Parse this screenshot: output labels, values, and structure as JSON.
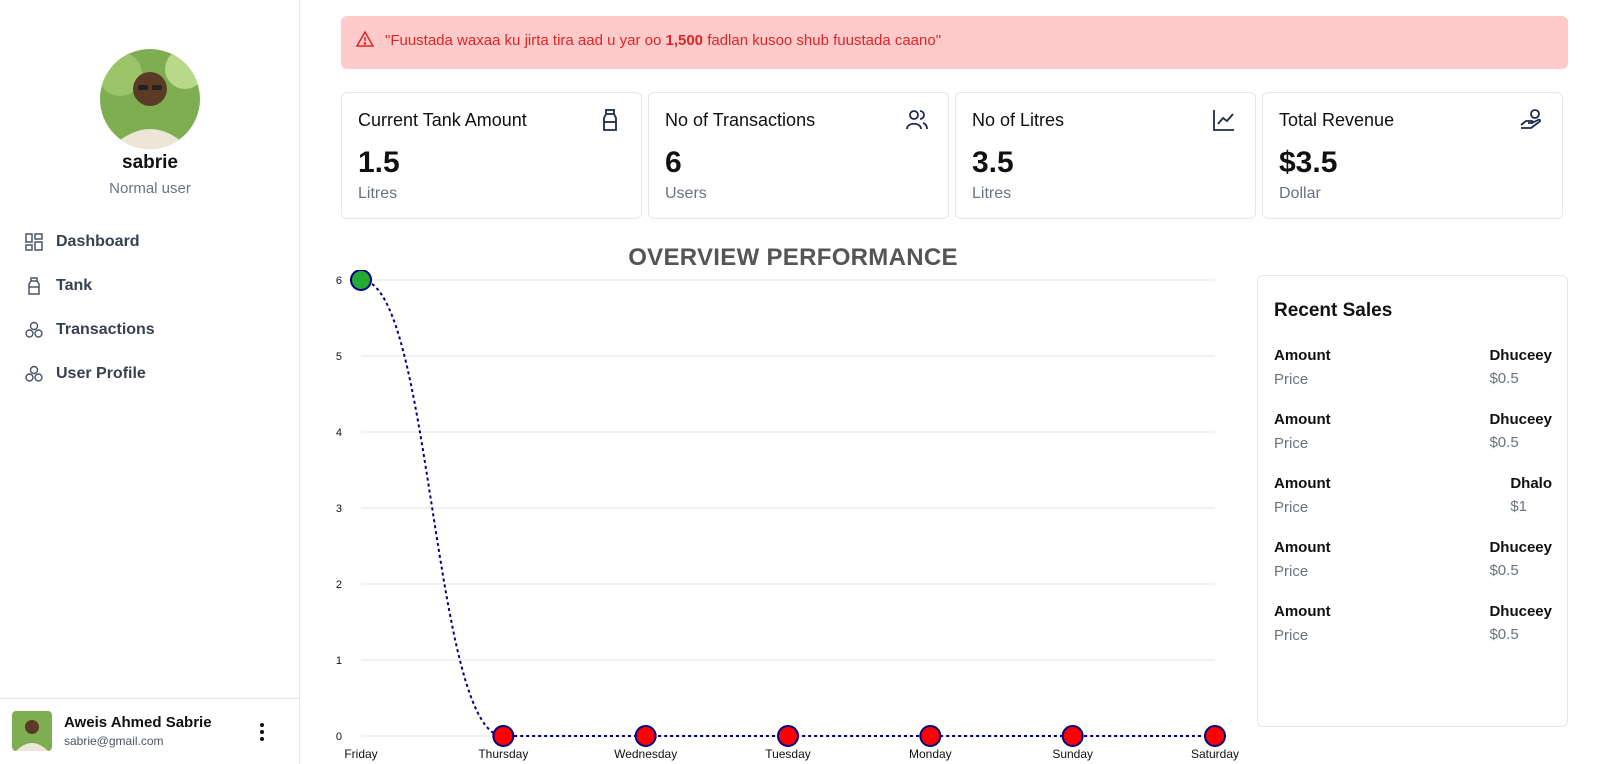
{
  "sidebar": {
    "profile": {
      "name": "sabrie",
      "role": "Normal user"
    },
    "nav": [
      {
        "label": "Dashboard",
        "icon": "dashboard-grid-icon"
      },
      {
        "label": "Tank",
        "icon": "bottle-icon"
      },
      {
        "label": "Transactions",
        "icon": "cubes-icon"
      },
      {
        "label": "User Profile",
        "icon": "cubes-icon"
      }
    ],
    "user": {
      "name": "Aweis Ahmed Sabrie",
      "email": "sabrie@gmail.com"
    }
  },
  "alert": {
    "prefix": "\"Fuustada waxaa ku jirta tira aad u yar oo ",
    "highlight": "1,500",
    "suffix": " fadlan kusoo shub fuustada caano\"",
    "icon": "warning-triangle-icon",
    "color": "#dc2626",
    "background": "#fecaca"
  },
  "stats": [
    {
      "title": "Current Tank Amount",
      "value": "1.5",
      "unit": "Litres",
      "icon": "bottle-icon"
    },
    {
      "title": "No of Transactions",
      "value": "6",
      "unit": "Users",
      "icon": "users-icon"
    },
    {
      "title": "No of Litres",
      "value": "3.5",
      "unit": "Litres",
      "icon": "line-chart-icon"
    },
    {
      "title": "Total Revenue",
      "value": "$3.5",
      "unit": "Dollar",
      "icon": "hand-coins-icon"
    }
  ],
  "chart_data": {
    "type": "line",
    "title": "OVERVIEW PERFORMANCE",
    "categories": [
      "Friday",
      "Thursday",
      "Wednesday",
      "Tuesday",
      "Monday",
      "Sunday",
      "Saturday"
    ],
    "values": [
      6,
      0,
      0,
      0,
      0,
      0,
      0
    ],
    "ylim": [
      0,
      6
    ],
    "yticks": [
      0,
      1,
      2,
      3,
      4,
      5,
      6
    ],
    "grid": true,
    "line_color": "#000080",
    "line_style": "dotted",
    "point_colors": {
      "highlight": "#22aa33",
      "default": "#ff0000"
    }
  },
  "recent_sales": {
    "title": "Recent Sales",
    "items": [
      {
        "label": "Amount",
        "sub": "Price",
        "name": "Dhuceey",
        "price": "$0.5"
      },
      {
        "label": "Amount",
        "sub": "Price",
        "name": "Dhuceey",
        "price": "$0.5"
      },
      {
        "label": "Amount",
        "sub": "Price",
        "name": "Dhalo",
        "price": "$1"
      },
      {
        "label": "Amount",
        "sub": "Price",
        "name": "Dhuceey",
        "price": "$0.5"
      },
      {
        "label": "Amount",
        "sub": "Price",
        "name": "Dhuceey",
        "price": "$0.5"
      }
    ]
  }
}
